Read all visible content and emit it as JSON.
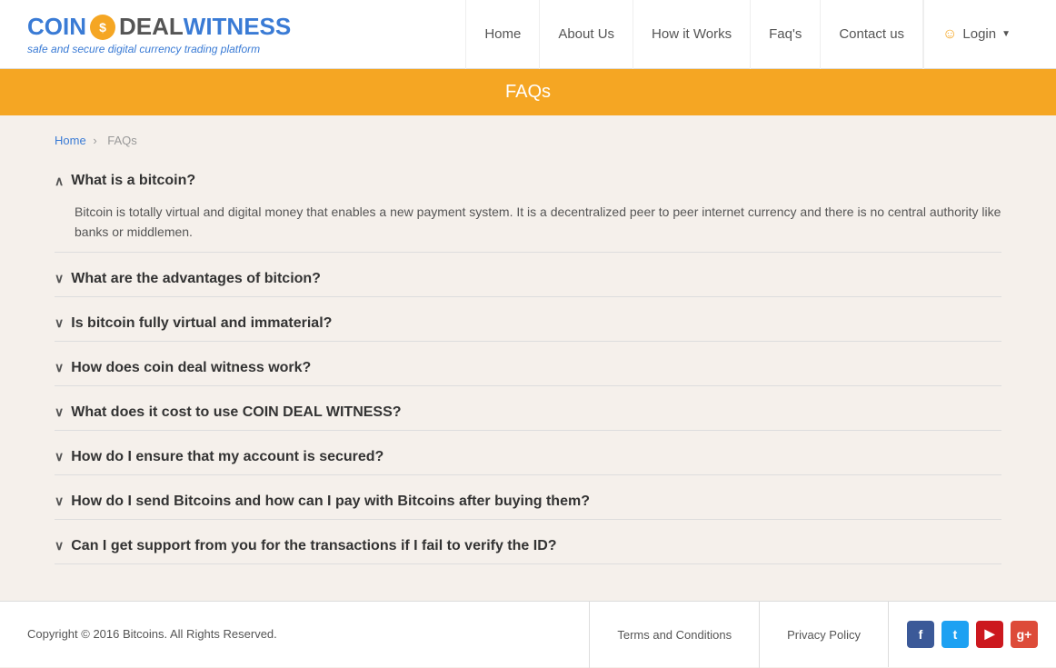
{
  "header": {
    "logo": {
      "coin": "COIN",
      "deal": "DEAL",
      "witness": "WITNESS",
      "tagline": "safe and secure digital currency trading platform"
    },
    "nav": {
      "home": "Home",
      "about": "About Us",
      "how_it_works": "How it Works",
      "faqs": "Faq's",
      "contact": "Contact us",
      "login": "Login"
    }
  },
  "banner": {
    "title": "FAQs"
  },
  "breadcrumb": {
    "home": "Home",
    "current": "FAQs"
  },
  "faqs": [
    {
      "question": "What is a bitcoin?",
      "answer": "Bitcoin is totally virtual and digital money that enables a new payment system. It is a decentralized peer to peer internet currency and there is no central authority like banks or middlemen.",
      "open": true
    },
    {
      "question": "What are the advantages of bitcion?",
      "answer": "",
      "open": false
    },
    {
      "question": "Is bitcoin fully virtual and immaterial?",
      "answer": "",
      "open": false
    },
    {
      "question": "How does coin deal witness work?",
      "answer": "",
      "open": false
    },
    {
      "question": "What does it cost to use COIN DEAL WITNESS?",
      "answer": "",
      "open": false
    },
    {
      "question": "How do I ensure that my account is secured?",
      "answer": "",
      "open": false
    },
    {
      "question": "How do I send Bitcoins and how can I pay with Bitcoins after buying them?",
      "answer": "",
      "open": false
    },
    {
      "question": "Can I get support from you for the transactions if I fail to verify the ID?",
      "answer": "",
      "open": false
    }
  ],
  "footer": {
    "copyright": "Copyright © 2016 Bitcoins. All Rights Reserved.",
    "terms": "Terms and Conditions",
    "privacy": "Privacy Policy",
    "social": {
      "facebook": "f",
      "twitter": "t",
      "youtube": "▶",
      "googleplus": "g+"
    }
  }
}
